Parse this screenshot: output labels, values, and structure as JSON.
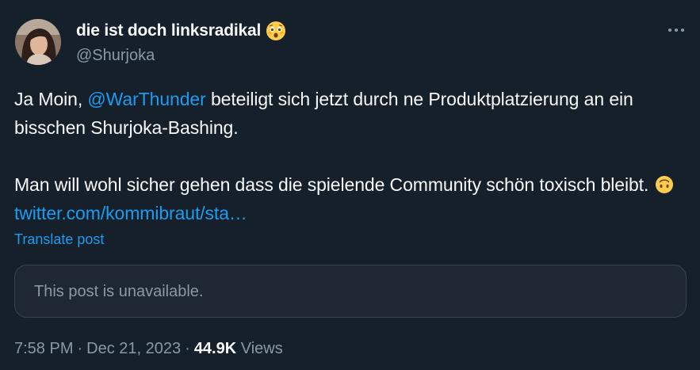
{
  "author": {
    "display_name": "die ist doch linksradikal",
    "name_emoji": "astonished-face-emoji",
    "handle": "@Shurjoka"
  },
  "post": {
    "line1_pre": "Ja Moin, ",
    "mention": "@WarThunder",
    "line1_post": " beteiligt sich jetzt durch ne Produktplatzierung an ein bisschen Shurjoka-Bashing.",
    "para2": "Man will wohl sicher gehen dass die spielende Community schön toxisch bleibt.",
    "inline_emoji": "upside-down-face-emoji",
    "link_text": "twitter.com/kommibraut/sta…"
  },
  "translate_label": "Translate post",
  "quoted_post": {
    "message": "This post is unavailable."
  },
  "meta": {
    "time": "7:58 PM",
    "separator": "·",
    "date": "Dec 21, 2023",
    "views_count": "44.9K",
    "views_label": "Views"
  },
  "colors": {
    "background": "#15202b",
    "text": "#f7f9f9",
    "secondary": "#8b98a5",
    "accent": "#1d9bf0",
    "border": "#38444d"
  },
  "icons": [
    "avatar",
    "more-options-icon",
    "astonished-face-emoji",
    "upside-down-face-emoji"
  ]
}
